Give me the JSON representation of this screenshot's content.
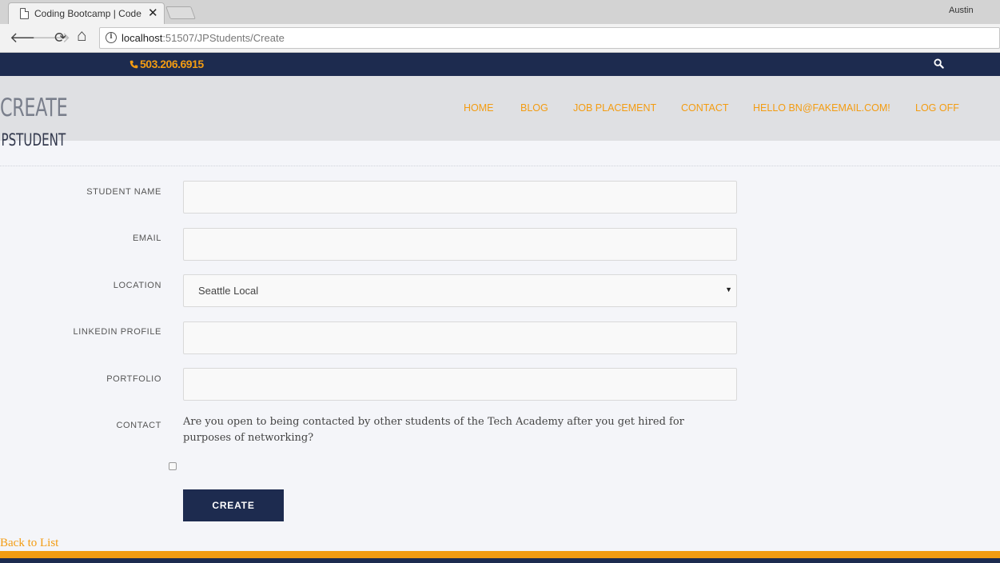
{
  "browser": {
    "tab_title": "Coding Bootcamp | Code",
    "tab_close": "✕",
    "profile_name": "Austin",
    "url_host": "localhost",
    "url_path": ":51507/JPStudents/Create",
    "back_icon": "🡐",
    "forward_icon": "🡒",
    "reload_icon": "⟳",
    "home_icon": "⌂"
  },
  "topbar": {
    "phone": "503.206.6915",
    "phone_icon": "phone-icon",
    "search_icon": "search-icon"
  },
  "header": {
    "title": "CREATE",
    "subtitle": "JPSTUDENT",
    "menu": [
      {
        "label": "HOME"
      },
      {
        "label": "BLOG"
      },
      {
        "label": "JOB PLACEMENT"
      },
      {
        "label": "CONTACT"
      },
      {
        "label": "HELLO BN@FAKEMAIL.COM!"
      },
      {
        "label": "LOG OFF"
      }
    ]
  },
  "form": {
    "student_name_label": "STUDENT NAME",
    "student_name_value": "",
    "email_label": "EMAIL",
    "email_value": "",
    "location_label": "LOCATION",
    "location_value": "Seattle Local",
    "linkedin_label": "LINKEDIN PROFILE",
    "linkedin_value": "",
    "portfolio_label": "PORTFOLIO",
    "portfolio_value": "",
    "contact_label": "CONTACT",
    "contact_question": "Are you open to being contacted by other students of the Tech Academy after you get hired for purposes of networking?",
    "contact_checked": false,
    "submit_label": "CREATE"
  },
  "back_link": "Back to List",
  "colors": {
    "navy": "#1d2b4f",
    "accent": "#f39c12",
    "page_bg": "#f4f5f9",
    "header_bg": "#dfe0e3"
  }
}
